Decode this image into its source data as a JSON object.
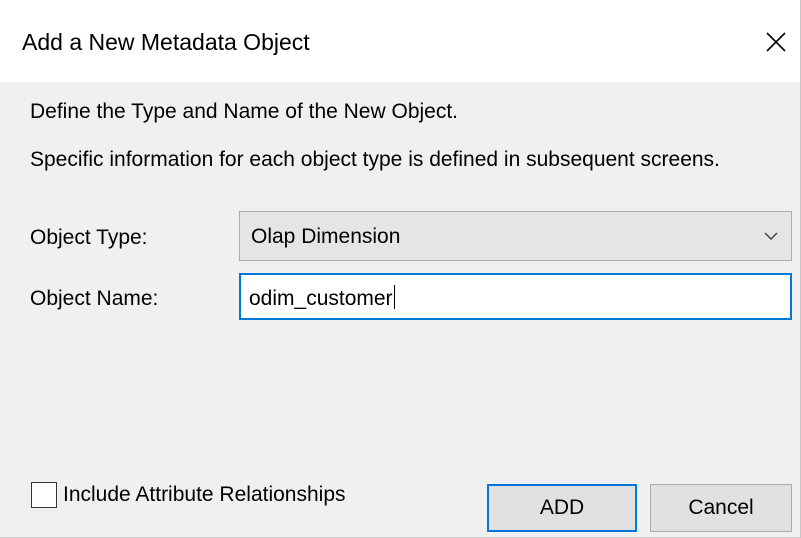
{
  "dialog": {
    "title": "Add a New Metadata Object",
    "close_icon": "close-icon"
  },
  "description": {
    "line1": "Define the Type and Name of the New Object.",
    "line2": "Specific information for each object type is defined in subsequent screens."
  },
  "form": {
    "object_type_label": "Object Type:",
    "object_type_value": "Olap Dimension",
    "object_type_icon": "chevron-down-icon",
    "object_name_label": "Object Name:",
    "object_name_value": "odim_customer"
  },
  "options": {
    "include_attribute_relationships_label": "Include Attribute Relationships",
    "include_attribute_relationships_checked": false
  },
  "buttons": {
    "add_label": "ADD",
    "cancel_label": "Cancel"
  },
  "colors": {
    "accent": "#0078d7",
    "dialog_bg": "#f0f0f0",
    "titlebar_bg": "#ffffff",
    "button_bg": "#e1e1e1"
  }
}
